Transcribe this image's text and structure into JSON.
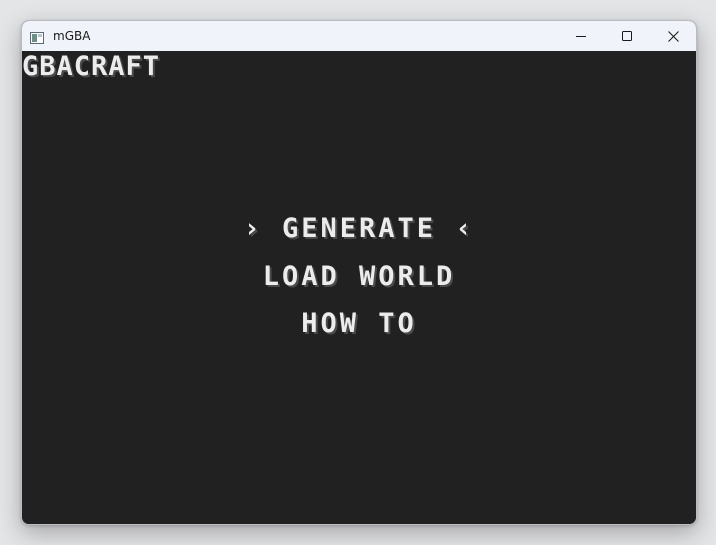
{
  "window": {
    "title": "mGBA",
    "icon": "mgba-app-icon",
    "controls": {
      "minimize": "minimize-icon",
      "maximize": "maximize-icon",
      "close": "close-icon"
    }
  },
  "game": {
    "title": "GBACRAFT",
    "menu": {
      "selected_prefix": "›",
      "selected_suffix": "‹",
      "items": [
        {
          "label": "GENERATE",
          "selected": true
        },
        {
          "label": "LOAD WORLD",
          "selected": false
        },
        {
          "label": "HOW TO",
          "selected": false
        }
      ]
    }
  },
  "colors": {
    "screen_background": "#212121",
    "text": "#ececec",
    "titlebar": "#f0f3f9"
  }
}
